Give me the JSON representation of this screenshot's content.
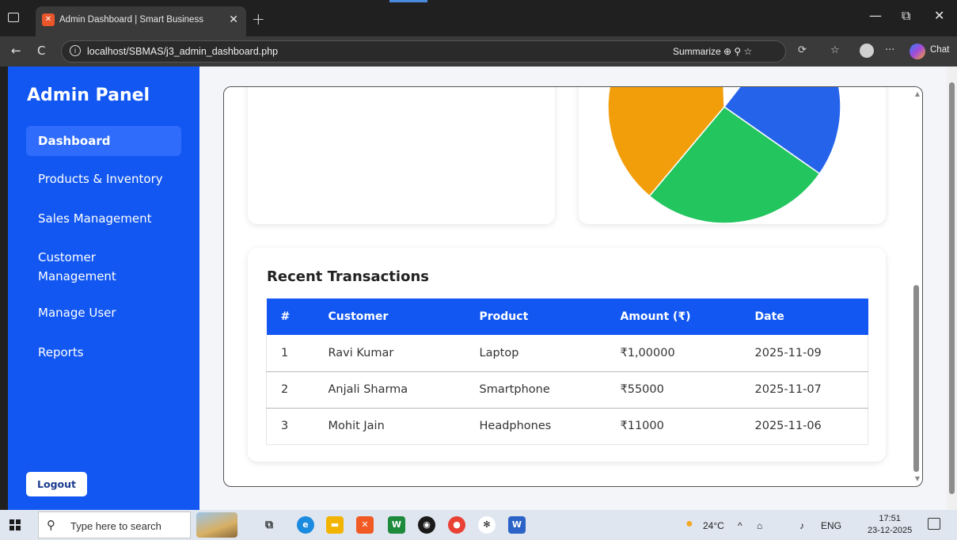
{
  "browser": {
    "tab_title": "Admin Dashboard | Smart Business",
    "tab_close": "✕",
    "new_tab": "+",
    "url": "localhost/SBMAS/j3_admin_dashboard.php",
    "summarize_label": "Summarize",
    "chat_label": "Chat",
    "minimize": "—",
    "restore": "⧉",
    "close": "✕",
    "back": "←",
    "refresh": "C",
    "more": "···"
  },
  "sidebar": {
    "brand": "Admin Panel",
    "items": [
      {
        "label": "Dashboard",
        "active": true
      },
      {
        "label": "Products & Inventory"
      },
      {
        "label": "Sales Management"
      },
      {
        "label": "Customer Management"
      },
      {
        "label": "Manage User"
      },
      {
        "label": "Reports"
      }
    ],
    "logout_label": "Logout"
  },
  "pie": {
    "colors": {
      "orange": "#f29e0b",
      "blue": "#2563eb",
      "green": "#22c55e"
    }
  },
  "transactions": {
    "title": "Recent Transactions",
    "columns": [
      "#",
      "Customer",
      "Product",
      "Amount (₹)",
      "Date"
    ],
    "rows": [
      [
        "1",
        "Ravi Kumar",
        "Laptop",
        "₹1,00000",
        "2025-11-09"
      ],
      [
        "2",
        "Anjali Sharma",
        "Smartphone",
        "₹55000",
        "2025-11-07"
      ],
      [
        "3",
        "Mohit Jain",
        "Headphones",
        "₹11000",
        "2025-11-06"
      ]
    ]
  },
  "taskbar": {
    "search_placeholder": "Type here to search",
    "temperature": "24°C",
    "language": "ENG",
    "time": "17:51",
    "date": "23-12-2025"
  },
  "colors": {
    "sidebar": "#1257f2",
    "accent": "#2f6cfb"
  }
}
